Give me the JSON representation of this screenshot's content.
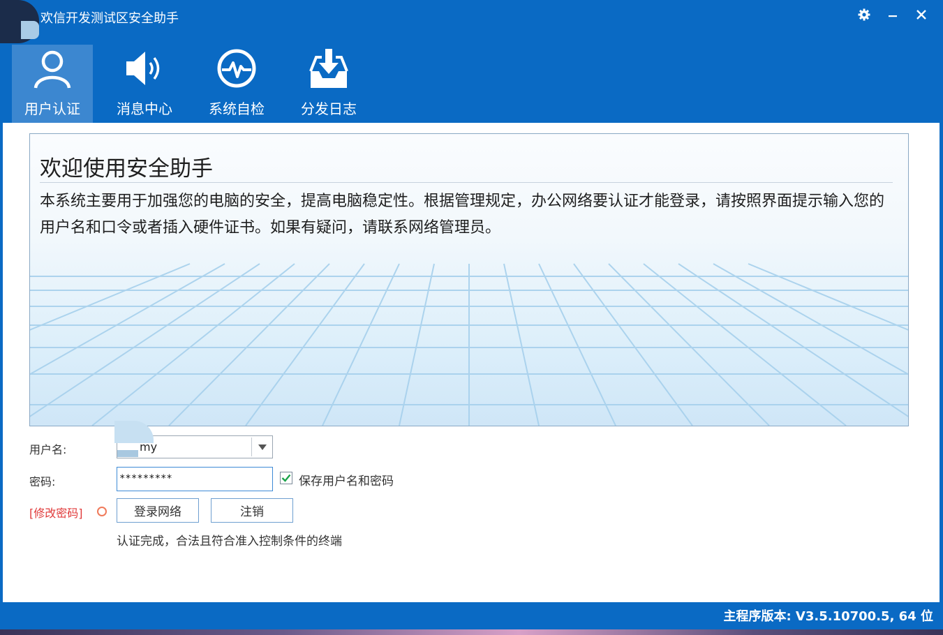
{
  "window": {
    "title": "欢信开发测试区安全助手"
  },
  "nav": {
    "items": [
      {
        "label": "用户认证",
        "icon": "user-icon",
        "active": true
      },
      {
        "label": "消息中心",
        "icon": "speaker-icon",
        "active": false
      },
      {
        "label": "系统自检",
        "icon": "heartbeat-icon",
        "active": false
      },
      {
        "label": "分发日志",
        "icon": "download-tray-icon",
        "active": false
      }
    ]
  },
  "welcome": {
    "title": "欢迎使用安全助手",
    "body": "本系统主要用于加强您的电脑的安全，提高电脑稳定性。根据管理规定，办公网络要认证才能登录，请按照界面提示输入您的用户名和口令或者插入硬件证书。如果有疑问，请联系网络管理员。"
  },
  "form": {
    "username_label": "用户名:",
    "username_value": "my",
    "password_label": "密码:",
    "password_value": "*********",
    "save_label": "保存用户名和密码",
    "save_checked": true,
    "change_password_link": "[修改密码]",
    "login_button": "登录网络",
    "logout_button": "注销",
    "status_text": "认证完成，合法且符合准入控制条件的终端"
  },
  "statusbar": {
    "version": "主程序版本: V3.5.10700.5, 64 位"
  },
  "colors": {
    "primary": "#0a6ac4",
    "nav_active": "#3c87d0",
    "link_red": "#e03a3a",
    "status_dot": "#f07a5a",
    "check_green": "#1aa34a"
  }
}
